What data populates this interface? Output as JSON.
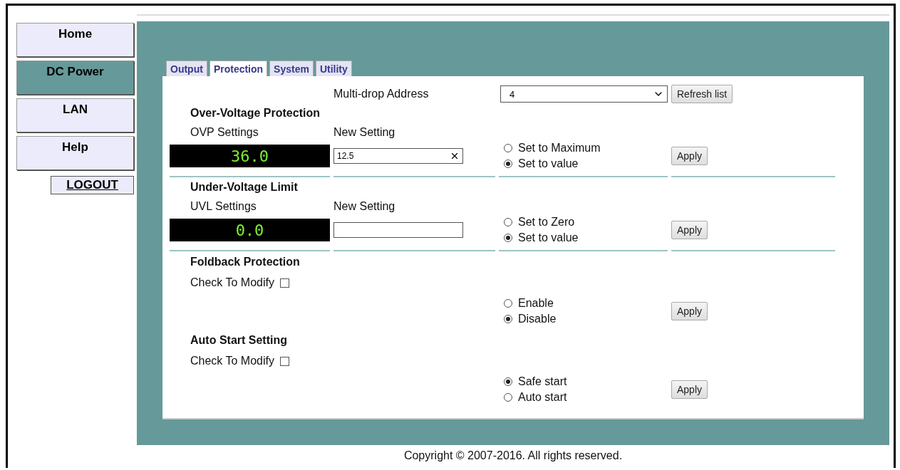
{
  "sidebar": {
    "items": [
      {
        "label": "Home",
        "selected": false
      },
      {
        "label": "DC Power",
        "selected": true
      },
      {
        "label": "LAN",
        "selected": false
      },
      {
        "label": "Help",
        "selected": false
      }
    ],
    "logout": "LOGOUT"
  },
  "tabs": [
    {
      "label": "Output",
      "selected": false
    },
    {
      "label": "Protection",
      "selected": true
    },
    {
      "label": "System",
      "selected": false
    },
    {
      "label": "Utility",
      "selected": false
    }
  ],
  "address": {
    "label": "Multi-drop Address",
    "value": "4",
    "button": "Refresh list"
  },
  "sections": [
    {
      "kind": "setting",
      "title": "Over-Voltage Protection",
      "settings_label": "OVP Settings",
      "new_setting_label": "New Setting",
      "reading": "36.0",
      "value": "12.5",
      "options": [
        {
          "label": "Set to Maximum",
          "selected": false
        },
        {
          "label": "Set to value",
          "selected": true
        }
      ],
      "button": "Apply"
    },
    {
      "kind": "setting",
      "title": "Under-Voltage Limit",
      "settings_label": "UVL Settings",
      "new_setting_label": "New Setting",
      "reading": "0.0",
      "options": [
        {
          "label": "Set to Zero",
          "selected": false
        },
        {
          "label": "Set to value",
          "selected": true
        }
      ],
      "button": "Apply"
    },
    {
      "kind": "check",
      "title": "Foldback Protection",
      "check_label": "Check To Modify",
      "checked": false,
      "options": [
        {
          "label": "Enable",
          "selected": false
        },
        {
          "label": "Disable",
          "selected": true
        }
      ],
      "button": "Apply"
    },
    {
      "kind": "check",
      "title": "Auto Start Setting",
      "check_label": "Check To Modify",
      "checked": false,
      "options": [
        {
          "label": "Safe start",
          "selected": true
        },
        {
          "label": "Auto start",
          "selected": false
        }
      ],
      "button": "Apply"
    }
  ],
  "footer": "Copyright © 2007-2016. All rights reserved."
}
